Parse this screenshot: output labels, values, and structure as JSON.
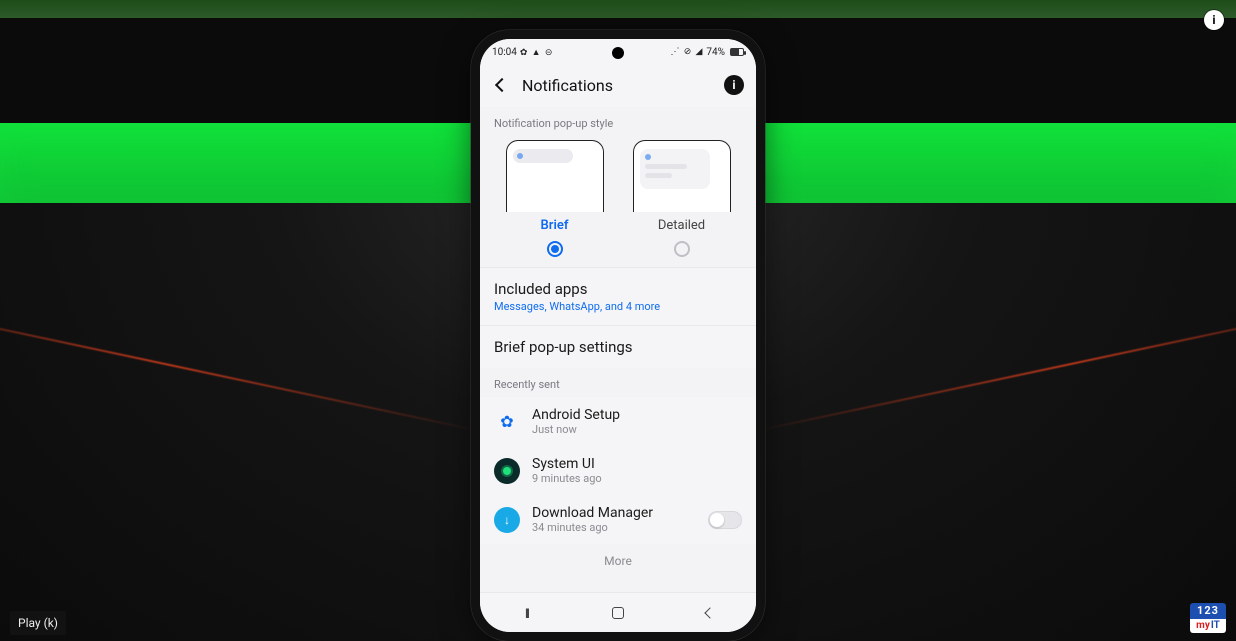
{
  "player": {
    "tooltip": "Play (k)",
    "info_glyph": "i",
    "logo_top": "123",
    "logo_my": "my",
    "logo_it": "IT"
  },
  "status": {
    "time": "10:04",
    "left_glyphs": "✿ ▲ ⊝",
    "right_glyphs": "⋰ ⊘ ◢",
    "battery": "74%"
  },
  "header": {
    "title": "Notifications",
    "info_glyph": "i"
  },
  "popup_style": {
    "label": "Notification pop-up style",
    "brief": "Brief",
    "detailed": "Detailed"
  },
  "included": {
    "title": "Included apps",
    "sub": "Messages, WhatsApp, and 4 more"
  },
  "brief_settings": {
    "title": "Brief pop-up settings"
  },
  "recent": {
    "label": "Recently sent",
    "items": [
      {
        "name": "Android Setup",
        "time": "Just now"
      },
      {
        "name": "System UI",
        "time": "9 minutes ago"
      },
      {
        "name": "Download Manager",
        "time": "34 minutes ago"
      }
    ],
    "more": "More"
  },
  "nav": {
    "recent_glyph": "III"
  }
}
